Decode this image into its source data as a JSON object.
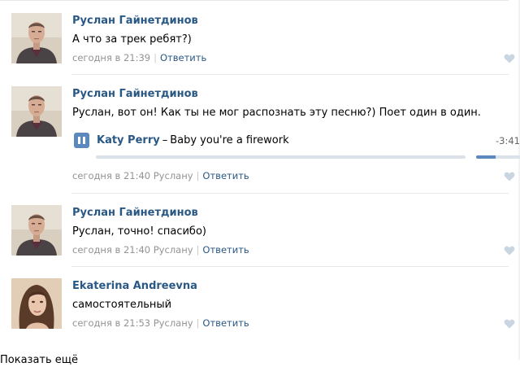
{
  "comments": [
    {
      "author": "Руслан Гайнетдинов",
      "text": "А что за трек ребят?)",
      "date": "сегодня в 21:39",
      "reply_to": "",
      "reply_label": "Ответить",
      "avatar": "avatar-ruslan"
    },
    {
      "author": "Руслан Гайнетдинов",
      "text": "Руслан, вот он! Как ты не мог распознать эту песню?) Поет один в один.",
      "date": "сегодня в 21:40",
      "reply_to": "Руслану",
      "reply_label": "Ответить",
      "avatar": "avatar-ruslan",
      "audio": {
        "artist": "Katy Perry",
        "dash": "–",
        "title": "Baby you're a firework",
        "duration": "-3:41",
        "state": "playing",
        "control_icon": "pause-icon",
        "progress": 0.0,
        "volume": 0.45
      }
    },
    {
      "author": "Руслан Гайнетдинов",
      "text": "Руслан, точно! спасибо)",
      "date": "сегодня в 21:40",
      "reply_to": "Руслану",
      "reply_label": "Ответить",
      "avatar": "avatar-ruslan"
    },
    {
      "author": "Ekaterina Andreevna",
      "text": "самостоятельный",
      "date": "сегодня в 21:53",
      "reply_to": "Руслану",
      "reply_label": "Ответить",
      "avatar": "avatar-ekaterina"
    }
  ],
  "colors": {
    "link": "#2a5885",
    "meta": "#939393",
    "accent": "#5b88bd",
    "track_bg": "#dae1e8",
    "like_icon": "#c9d5e1",
    "divider": "#e7e8ec"
  },
  "footer": {
    "cutoff_text": "Показать ещё"
  }
}
